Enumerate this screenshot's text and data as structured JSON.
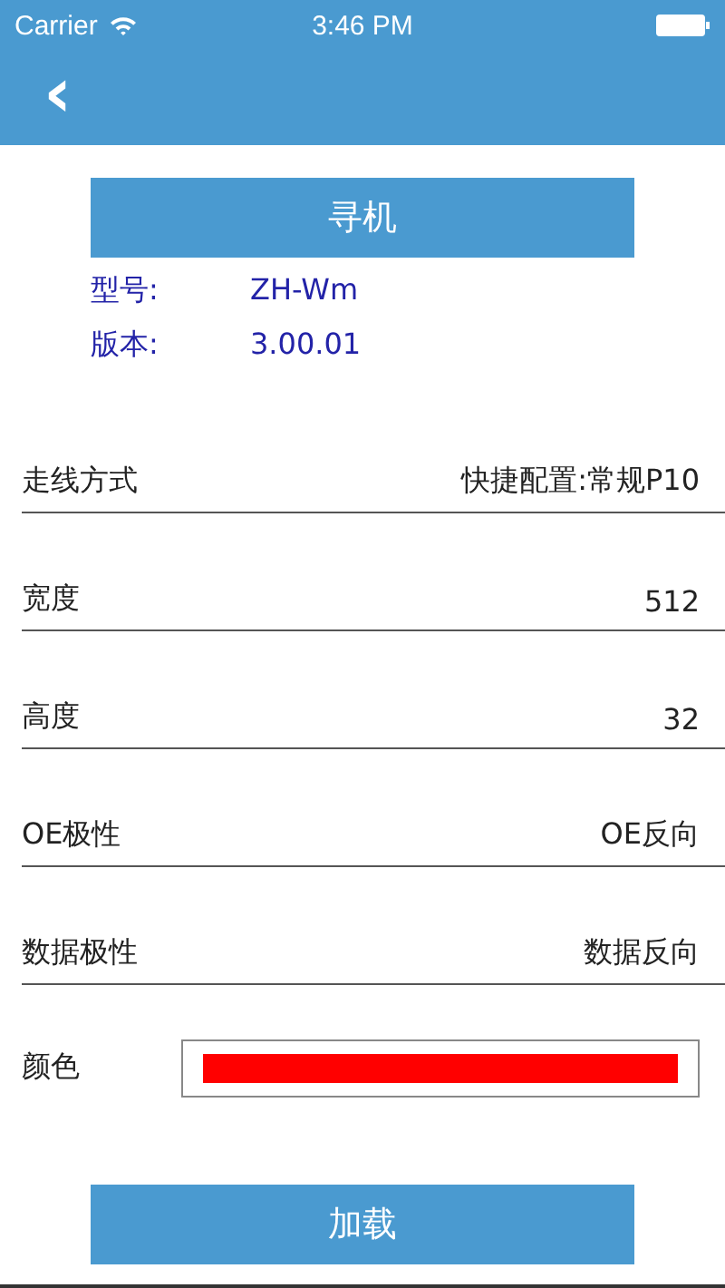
{
  "status_bar": {
    "carrier": "Carrier",
    "time": "3:46 PM"
  },
  "nav": {
    "back": "‹"
  },
  "search_button": "寻机",
  "info": [
    {
      "label": "型号:",
      "value": "ZH-Wm"
    },
    {
      "label": "版本:",
      "value": "3.00.01"
    }
  ],
  "settings": [
    {
      "kind": "text",
      "label": "走线方式",
      "value": "快捷配置:常规P10"
    },
    {
      "kind": "text",
      "label": "宽度",
      "value": "512"
    },
    {
      "kind": "text",
      "label": "高度",
      "value": "32"
    },
    {
      "kind": "text",
      "label": "OE极性",
      "value": "OE反向"
    },
    {
      "kind": "text",
      "label": "数据极性",
      "value": "数据反向"
    },
    {
      "kind": "color",
      "label": "颜色",
      "color": "#ff0000"
    }
  ],
  "load_button": "加载"
}
